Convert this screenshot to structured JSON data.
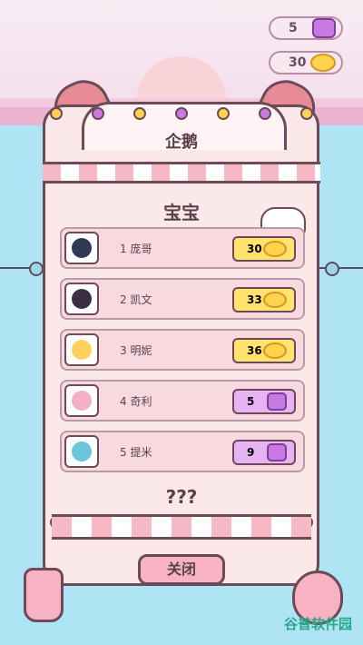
{
  "hud": {
    "gems": "5",
    "fish": "30"
  },
  "title": "企鹅",
  "subtitle": "宝宝",
  "rows": [
    {
      "rank": "1",
      "name": "庞哥",
      "reward": "30",
      "reward_type": "fish",
      "avatar_color": "#2f3a56"
    },
    {
      "rank": "2",
      "name": "凯文",
      "reward": "33",
      "reward_type": "fish",
      "avatar_color": "#3b2f45"
    },
    {
      "rank": "3",
      "name": "明妮",
      "reward": "36",
      "reward_type": "fish",
      "avatar_color": "#ffd15c"
    },
    {
      "rank": "4",
      "name": "奇利",
      "reward": "5",
      "reward_type": "gem",
      "avatar_color": "#f3b0c6"
    },
    {
      "rank": "5",
      "name": "提米",
      "reward": "9",
      "reward_type": "gem",
      "avatar_color": "#68c7db"
    }
  ],
  "unknown": "???",
  "close_label": "关闭",
  "watermark": "谷普软件园",
  "colors": {
    "accent": "#f7b3c3",
    "sea": "#aee4f4",
    "panel": "#fbe8e8"
  }
}
